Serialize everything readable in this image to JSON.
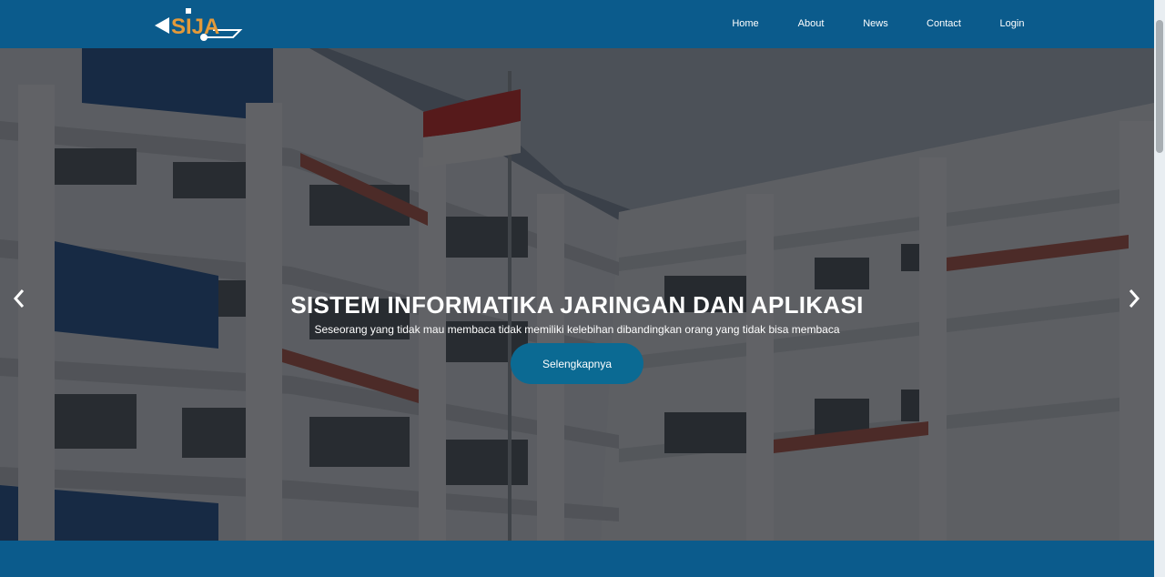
{
  "brand": {
    "logo_text": "SIJA"
  },
  "nav": {
    "items": [
      {
        "label": "Home"
      },
      {
        "label": "About"
      },
      {
        "label": "News"
      },
      {
        "label": "Contact"
      },
      {
        "label": "Login"
      }
    ]
  },
  "hero": {
    "title": "SISTEM INFORMATIKA JARINGAN DAN APLIKASI",
    "subtitle": "Seseorang yang tidak mau membaca tidak memiliki kelebihan dibandingkan orang yang tidak bisa membaca",
    "button_label": "Selengkapnya"
  },
  "colors": {
    "navbar": "#0b5b8c",
    "button": "#0b6a93",
    "logo_accent": "#e39a3a"
  }
}
